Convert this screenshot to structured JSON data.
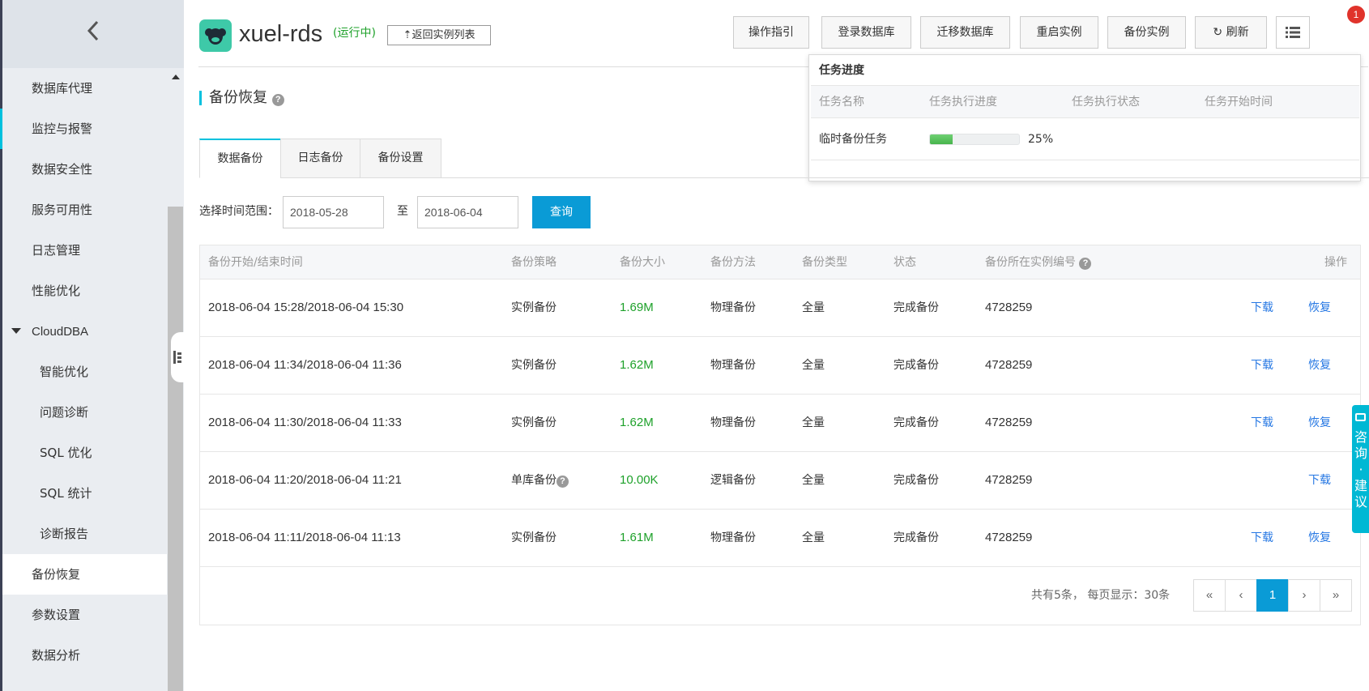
{
  "sidebar": {
    "items": [
      {
        "label": "数据库代理"
      },
      {
        "label": "监控与报警"
      },
      {
        "label": "数据安全性"
      },
      {
        "label": "服务可用性"
      },
      {
        "label": "日志管理"
      },
      {
        "label": "性能优化"
      },
      {
        "label": "CloudDBA"
      },
      {
        "label": "智能优化"
      },
      {
        "label": "问题诊断"
      },
      {
        "label": "SQL 优化"
      },
      {
        "label": "SQL 统计"
      },
      {
        "label": "诊断报告"
      },
      {
        "label": "备份恢复"
      },
      {
        "label": "参数设置"
      },
      {
        "label": "数据分析"
      }
    ]
  },
  "header": {
    "instance_name": "xuel-rds",
    "status": "(运行中)",
    "back_label": "返回实例列表",
    "buttons": {
      "guide": "操作指引",
      "login": "登录数据库",
      "migrate": "迁移数据库",
      "restart": "重启实例",
      "backup": "备份实例",
      "refresh": "刷新"
    },
    "notification_count": "1"
  },
  "task_panel": {
    "title": "任务进度",
    "columns": [
      "任务名称",
      "任务执行进度",
      "任务执行状态",
      "任务开始时间"
    ],
    "tasks": [
      {
        "name": "临时备份任务",
        "progress_label": "25%",
        "progress": 0.25
      }
    ]
  },
  "page": {
    "title": "备份恢复",
    "tabs": [
      {
        "label": "数据备份"
      },
      {
        "label": "日志备份"
      },
      {
        "label": "备份设置"
      }
    ]
  },
  "filter": {
    "label": "选择时间范围：",
    "start": "2018-05-28",
    "to": "至",
    "end": "2018-06-04",
    "query": "查询"
  },
  "table": {
    "columns": [
      "备份开始/结束时间",
      "备份策略",
      "备份大小",
      "备份方法",
      "备份类型",
      "状态",
      "备份所在实例编号",
      "操作"
    ],
    "rows": [
      {
        "time": "2018-06-04 15:28/2018-06-04 15:30",
        "policy": "实例备份",
        "size": "1.69M",
        "method": "物理备份",
        "type": "全量",
        "status": "完成备份",
        "instance": "4728259",
        "download": "下载",
        "restore": "恢复"
      },
      {
        "time": "2018-06-04 11:34/2018-06-04 11:36",
        "policy": "实例备份",
        "size": "1.62M",
        "method": "物理备份",
        "type": "全量",
        "status": "完成备份",
        "instance": "4728259",
        "download": "下载",
        "restore": "恢复"
      },
      {
        "time": "2018-06-04 11:30/2018-06-04 11:33",
        "policy": "实例备份",
        "size": "1.62M",
        "method": "物理备份",
        "type": "全量",
        "status": "完成备份",
        "instance": "4728259",
        "download": "下载",
        "restore": "恢复"
      },
      {
        "time": "2018-06-04 11:20/2018-06-04 11:21",
        "policy": "单库备份",
        "size": "10.00K",
        "method": "逻辑备份",
        "type": "全量",
        "status": "完成备份",
        "instance": "4728259",
        "download": "下载",
        "restore": ""
      },
      {
        "time": "2018-06-04 11:11/2018-06-04 11:13",
        "policy": "实例备份",
        "size": "1.61M",
        "method": "物理备份",
        "type": "全量",
        "status": "完成备份",
        "instance": "4728259",
        "download": "下载",
        "restore": "恢复"
      }
    ]
  },
  "pagination": {
    "info": "共有5条， 每页显示：30条",
    "first": "«",
    "prev": "‹",
    "current": "1",
    "next": "›",
    "last": "»"
  },
  "consult": {
    "label": "咨询·建议"
  },
  "colors": {
    "accent": "#00c1de",
    "primary_button": "#0a9bd6",
    "success_text": "#1ea12a",
    "link": "#2577e3",
    "badge": "#e0332b"
  }
}
